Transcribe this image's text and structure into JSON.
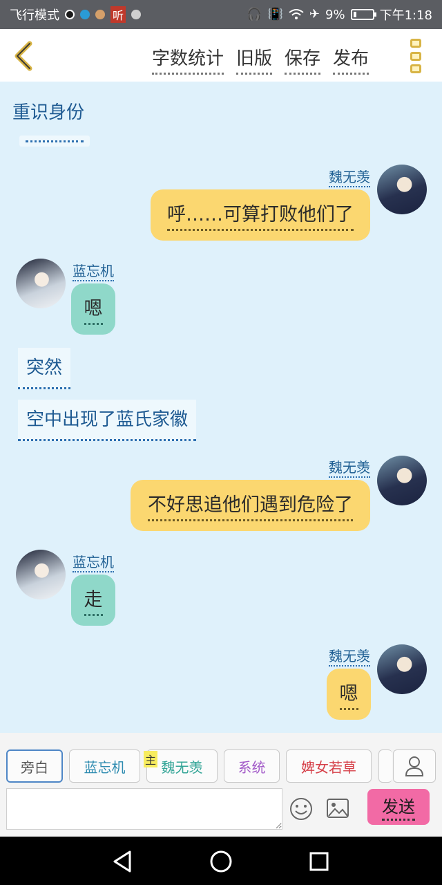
{
  "status_bar": {
    "left_text": "飞行模式",
    "notification_badge": "听",
    "battery_text": "9%",
    "time": "下午1:18",
    "icons": [
      "headset-icon",
      "vibrate-icon",
      "wifi-icon",
      "airplane-icon",
      "battery-icon"
    ]
  },
  "header": {
    "actions": [
      "字数统计",
      "旧版",
      "保存",
      "发布"
    ],
    "back_icon": "chevron-left-icon",
    "more_icon": "more-vertical-icon"
  },
  "chat": {
    "scene_title": "重识身份",
    "narrations": [
      "突然",
      "空中出现了蓝氏家徽"
    ],
    "messages": [
      {
        "speaker": "魏无羡",
        "text": "呼……可算打败他们了",
        "side": "right"
      },
      {
        "speaker": "蓝忘机",
        "text": "嗯",
        "side": "left"
      },
      {
        "speaker": "魏无羡",
        "text": "不好思追他们遇到危险了",
        "side": "right"
      },
      {
        "speaker": "蓝忘机",
        "text": "走",
        "side": "left"
      },
      {
        "speaker": "魏无羡",
        "text": "嗯",
        "side": "right"
      }
    ]
  },
  "roles": {
    "chips": [
      "旁白",
      "蓝忘机",
      "魏无羡",
      "系统",
      "婢女若草"
    ],
    "main_badge": "主",
    "active_index": 0
  },
  "composer": {
    "placeholder": "",
    "send_label": "发送",
    "emoji_icon": "emoji-icon",
    "image_icon": "image-icon",
    "person_icon": "person-icon"
  },
  "colors": {
    "status_bar": "#5b5d62",
    "chat_background": "#dff1fb",
    "right_bubble": "#fbd770",
    "left_bubble": "#8fd8c9",
    "send_button": "#f26aa5",
    "name_text": "#1f5f93"
  }
}
